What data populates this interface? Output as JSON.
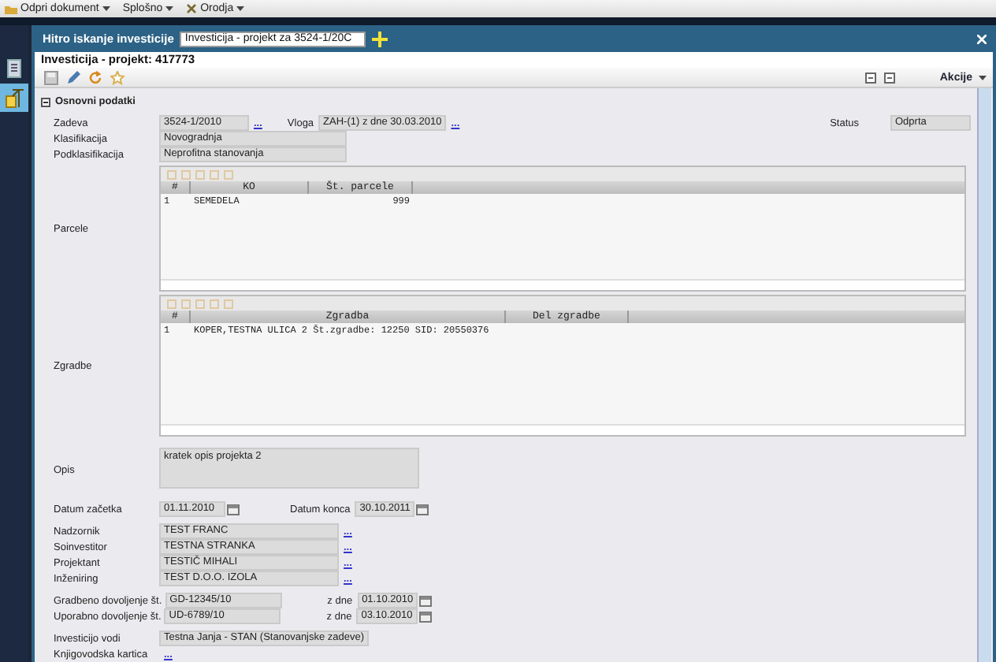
{
  "menu": [
    {
      "label": "Odpri dokument"
    },
    {
      "label": "Splošno"
    },
    {
      "label": "Orodja"
    }
  ],
  "quick_search": {
    "label": "Hitro iskanje investicije",
    "value": "Investicija - projekt za 3524-1/20C"
  },
  "document_title": "Investicija - projekt: 417773",
  "actions_menu": "Akcije",
  "section": {
    "title": "Osnovni podatki",
    "expanded": true
  },
  "zadeva": {
    "label": "Zadeva",
    "value": "3524-1/2010",
    "lookup": "..."
  },
  "vloga": {
    "label": "Vloga",
    "value": "ZAH-(1) z dne 30.03.2010",
    "lookup": "..."
  },
  "status": {
    "label": "Status",
    "value": "Odprta"
  },
  "klasifikacija": {
    "label": "Klasifikacija",
    "value": "Novogradnja"
  },
  "podklasifikacija": {
    "label": "Podklasifikacija",
    "value": "Neprofitna stanovanja"
  },
  "parcele": {
    "label": "Parcele",
    "columns": [
      "#",
      "KO",
      "Št. parcele"
    ],
    "rows": [
      [
        "1",
        "SEMEDELA",
        "999"
      ]
    ]
  },
  "zgradbe": {
    "label": "Zgradbe",
    "columns": [
      "#",
      "Zgradba",
      "Del zgradbe"
    ],
    "rows": [
      [
        "1",
        "KOPER,TESTNA ULICA 2 Št.zgradbe: 12250 SID: 20550376"
      ]
    ]
  },
  "opis": {
    "label": "Opis",
    "value": "kratek opis projekta 2"
  },
  "datum_zacetka": {
    "label": "Datum začetka",
    "value": "01.11.2010"
  },
  "datum_konca": {
    "label": "Datum konca",
    "value": "30.10.2011"
  },
  "persons": [
    {
      "label": "Nadzornik",
      "value": "TEST FRANC",
      "lookup": "..."
    },
    {
      "label": "Soinvestitor",
      "value": "TESTNA STRANKA",
      "lookup": "..."
    },
    {
      "label": "Projektant",
      "value": "TESTIČ MIHALI",
      "lookup": "..."
    },
    {
      "label": "Inženiring",
      "value": "TEST D.O.O. IZOLA",
      "lookup": "..."
    }
  ],
  "permits": [
    {
      "label": "Gradbeno dovoljenje št.",
      "value": "GD-12345/10",
      "date_label": "z dne",
      "date": "01.10.2010"
    },
    {
      "label": "Uporabno dovoljenje št.",
      "value": "UD-6789/10",
      "date_label": "z dne",
      "date": "03.10.2010"
    }
  ],
  "investicijo_vodi": {
    "label": "Investicijo vodi",
    "value": "Testna Janja - STAN (Stanovanjske zadeve)"
  },
  "knjigovodska_kartica": {
    "label": "Knjigovodska kartica",
    "lookup": "..."
  }
}
